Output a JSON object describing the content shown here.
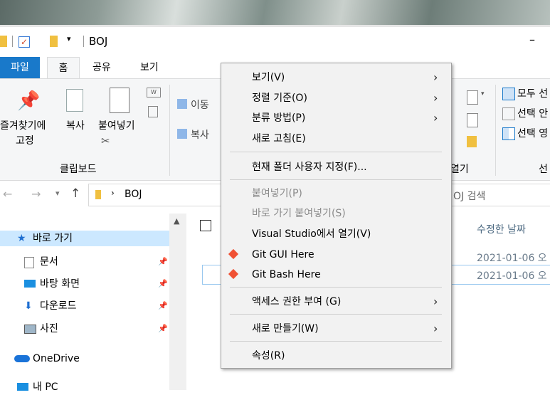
{
  "window": {
    "title": "BOJ",
    "minimize_glyph": "–"
  },
  "ribbon_tabs": {
    "file": "파일",
    "home": "홈",
    "share": "공유",
    "view": "보기"
  },
  "ribbon": {
    "pin_label_line1": "즐겨찾기에",
    "pin_label_line2": "고정",
    "copy_label": "복사",
    "paste_label": "붙여넣기",
    "clipboard_group": "클립보드",
    "move_label": "이동",
    "copyto_label": "복사",
    "open_group_partial": "열기",
    "select_all": "모두 선",
    "select_none": "선택 안",
    "invert_select": "선택 영",
    "select_group_partial": "선"
  },
  "address": {
    "path": "BOJ",
    "search_placeholder": "OJ 검색"
  },
  "nav": {
    "quick_access": "바로 가기",
    "documents": "문서",
    "desktop": "바탕 화면",
    "downloads": "다운로드",
    "pictures": "사진",
    "onedrive": "OneDrive",
    "this_pc": "내 PC"
  },
  "file_list": {
    "col_modified": "수정한 날짜",
    "rows": [
      {
        "modified": "2021-01-06 오"
      },
      {
        "modified": "2021-01-06 오"
      }
    ]
  },
  "context_menu": {
    "items": [
      {
        "label": "보기(V)"
      },
      {
        "label": "정렬 기준(O)"
      },
      {
        "label": "분류 방법(P)"
      },
      {
        "label": "새로 고침(E)"
      },
      {
        "label": "현재 폴더 사용자 지정(F)..."
      },
      {
        "label": "붙여넣기(P)"
      },
      {
        "label": "바로 가기 붙여넣기(S)"
      },
      {
        "label": "Visual Studio에서 열기(V)"
      },
      {
        "label": "Git GUI Here"
      },
      {
        "label": "Git Bash Here"
      },
      {
        "label": "액세스 권한 부여 (G)"
      },
      {
        "label": "새로 만들기(W)"
      },
      {
        "label": "속성(R)"
      }
    ]
  },
  "colors": {
    "accent": "#0063b1",
    "folder": "#f0c040",
    "git": "#f05133"
  }
}
